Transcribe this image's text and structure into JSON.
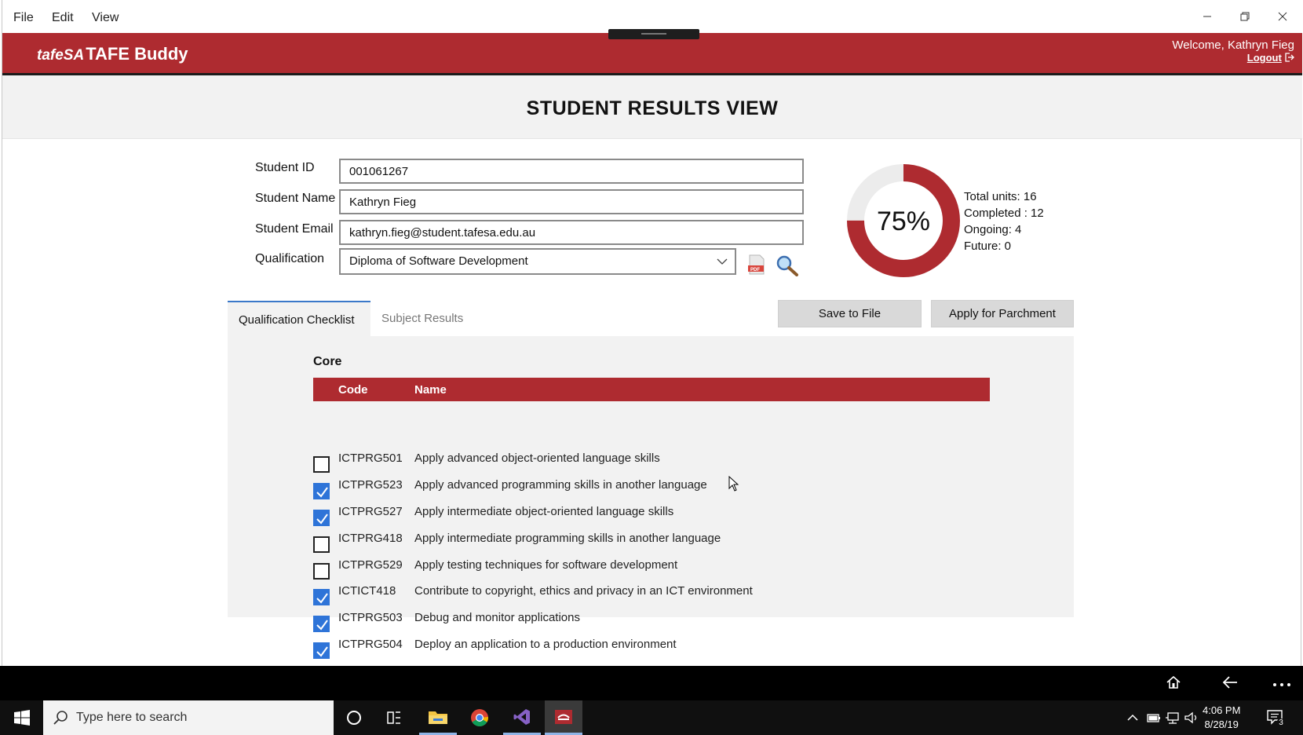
{
  "menu": {
    "file": "File",
    "edit": "Edit",
    "view": "View"
  },
  "header": {
    "logo_small": "tafeSA",
    "logo_main": "TAFE Buddy",
    "welcome": "Welcome, Kathryn Fieg",
    "logout": "Logout"
  },
  "page_title": "STUDENT RESULTS VIEW",
  "form": {
    "student_id_label": "Student ID",
    "student_id_value": "001061267",
    "student_name_label": "Student Name",
    "student_name_value": "Kathryn Fieg",
    "student_email_label": "Student Email",
    "student_email_value": "kathryn.fieg@student.tafesa.edu.au",
    "qualification_label": "Qualification",
    "qualification_value": "Diploma of Software Development"
  },
  "progress": {
    "percent_label": "75%",
    "percent_value": 0.75,
    "total": "Total units: 16",
    "completed": "Completed : 12",
    "ongoing": "Ongoing: 4",
    "future": "Future: 0",
    "accent_color": "#ae2b30",
    "track_color": "#ececec"
  },
  "tabs": {
    "checklist": "Qualification Checklist",
    "subject_results": "Subject Results"
  },
  "actions": {
    "save": "Save to File",
    "parchment": "Apply for Parchment"
  },
  "checklist": {
    "heading": "Core",
    "col_code": "Code",
    "col_name": "Name",
    "rows": [
      {
        "code": "ICTPRG501",
        "name": "Apply advanced object-oriented language skills",
        "checked": false
      },
      {
        "code": "ICTPRG523",
        "name": "Apply advanced programming skills in another language",
        "checked": true
      },
      {
        "code": "ICTPRG527",
        "name": "Apply intermediate object-oriented language skills",
        "checked": true
      },
      {
        "code": "ICTPRG418",
        "name": "Apply intermediate programming skills in another language",
        "checked": false
      },
      {
        "code": "ICTPRG529",
        "name": "Apply testing techniques for software development",
        "checked": false
      },
      {
        "code": "ICTICT418",
        "name": "Contribute to copyright, ethics and privacy in an ICT environment",
        "checked": true
      },
      {
        "code": "ICTPRG503",
        "name": "Debug and monitor applications",
        "checked": true
      },
      {
        "code": "ICTPRG504",
        "name": "Deploy an application to a production environment",
        "checked": true
      }
    ]
  },
  "taskbar": {
    "search_placeholder": "Type here to search",
    "time": "4:06 PM",
    "date": "8/28/19",
    "notification_count": "3"
  }
}
